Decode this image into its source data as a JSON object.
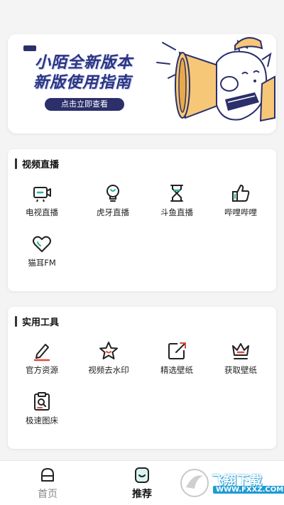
{
  "banner": {
    "line1": "小陌全新版本",
    "line2": "新版使用指南",
    "button_label": "点击立即查看"
  },
  "live_section": {
    "title": "视频直播",
    "items": [
      {
        "label": "电视直播",
        "icon": "tv-icon"
      },
      {
        "label": "虎牙直播",
        "icon": "lightbulb-icon"
      },
      {
        "label": "斗鱼直播",
        "icon": "hourglass-icon"
      },
      {
        "label": "哔哩哔哩",
        "icon": "thumbs-up-icon"
      },
      {
        "label": "猫耳FM",
        "icon": "heart-icon"
      }
    ]
  },
  "tools_section": {
    "title": "实用工具",
    "items": [
      {
        "label": "官方资源",
        "icon": "pencil-icon"
      },
      {
        "label": "视频去水印",
        "icon": "star-icon"
      },
      {
        "label": "精选壁纸",
        "icon": "share-box-icon"
      },
      {
        "label": "获取壁纸",
        "icon": "crown-icon"
      },
      {
        "label": "极速图床",
        "icon": "clipboard-search-icon"
      }
    ]
  },
  "tabbar": {
    "home": "首页",
    "recommend": "推荐"
  },
  "watermark": {
    "text": "飞翔下载",
    "url": "WWW.FXXZ.COM"
  },
  "colors": {
    "accent_navy": "#2b2f6a",
    "icon_teal": "#27b5a0",
    "icon_red": "#e04a3c"
  }
}
